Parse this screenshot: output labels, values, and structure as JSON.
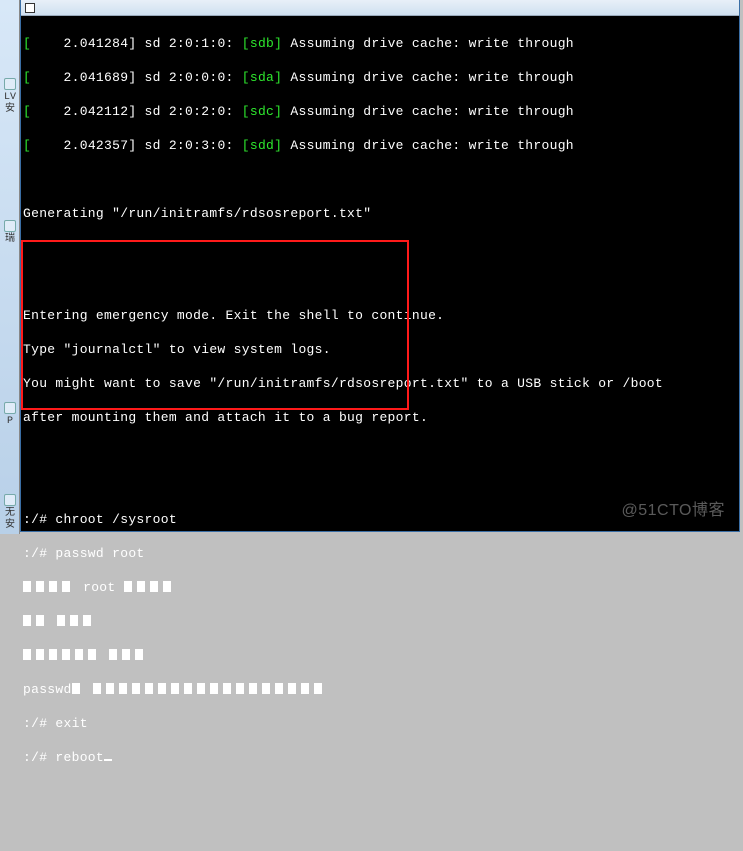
{
  "watermark": "@51CTO博客",
  "leftStrip": {
    "ib1": "LV\n安",
    "ib2": "瑞",
    "ib3": "P",
    "ib4": "无\n安"
  },
  "kernel": {
    "l1_bracket": "[",
    "l1a": "    2.041284] sd 2:0:1:0: ",
    "l1b": "[sdb]",
    "l1c": " Assuming drive cache: write through",
    "l2a": "    2.041689] sd 2:0:0:0: ",
    "l2b": "[sda]",
    "l2c": " Assuming drive cache: write through",
    "l3a": "    2.042112] sd 2:0:2:0: ",
    "l3b": "[sdc]",
    "l3c": " Assuming drive cache: write through",
    "l4a": "    2.042357] sd 2:0:3:0: ",
    "l4b": "[sdd]",
    "l4c": " Assuming drive cache: write through"
  },
  "gen": {
    "line": "Generating \"/run/initramfs/rdsosreport.txt\""
  },
  "msg": {
    "m1": "Entering emergency mode. Exit the shell to continue.",
    "m2": "Type \"journalctl\" to view system logs.",
    "m3": "You might want to save \"/run/initramfs/rdsosreport.txt\" to a USB stick or /boot",
    "m4": "after mounting them and attach it to a bug report."
  },
  "shell": {
    "s1": ":/# chroot /sysroot",
    "s2": ":/# passwd root",
    "s3pre": " root ",
    "s6pre": "passwd",
    "s7": ":/# exit",
    "s8": ":/# reboot"
  }
}
